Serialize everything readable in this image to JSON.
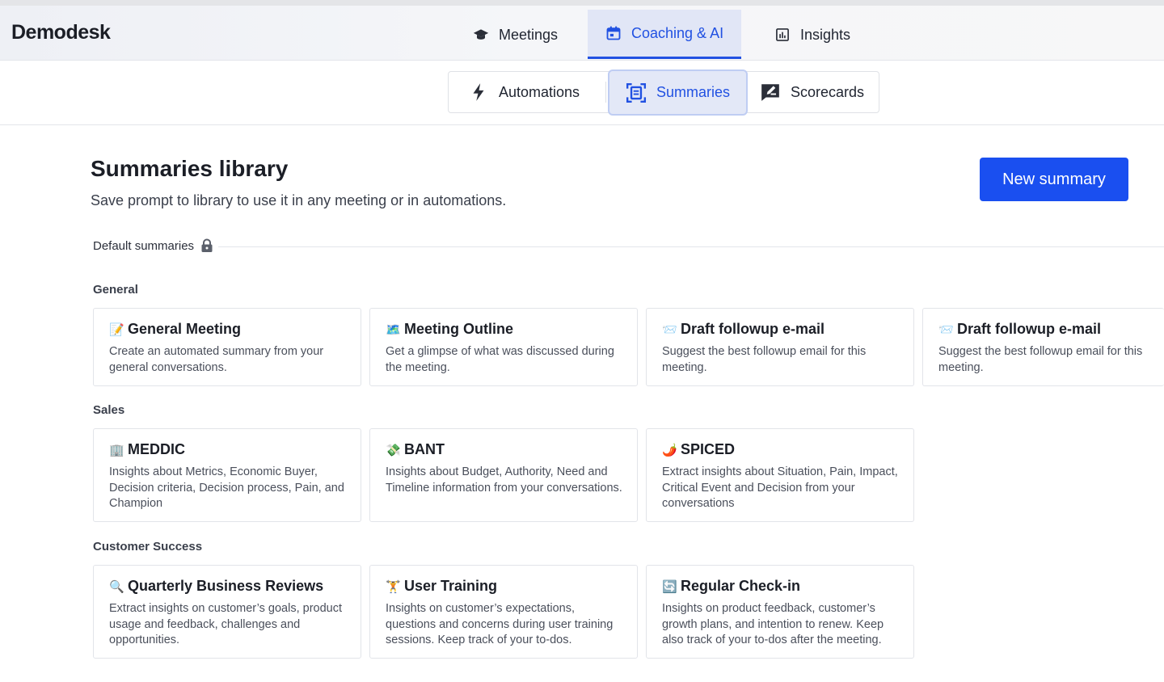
{
  "app": {
    "logo": "Demodesk"
  },
  "main_nav": [
    {
      "label": "Meetings",
      "icon": "graduation-cap-icon",
      "active": false
    },
    {
      "label": "Coaching & AI",
      "icon": "calendar-icon",
      "active": true
    },
    {
      "label": "Insights",
      "icon": "bar-chart-icon",
      "active": false
    }
  ],
  "sub_nav": [
    {
      "label": "Automations",
      "icon": "lightning-icon",
      "active": false
    },
    {
      "label": "Summaries",
      "icon": "document-scan-icon",
      "active": true
    },
    {
      "label": "Scorecards",
      "icon": "scorecard-edit-icon",
      "active": false
    }
  ],
  "page": {
    "title": "Summaries library",
    "subtitle": "Save prompt to library to use it in any meeting or in automations.",
    "new_button": "New summary",
    "default_label": "Default summaries"
  },
  "sections": [
    {
      "label": "General",
      "cards": [
        {
          "emoji": "📝",
          "title": "General Meeting",
          "desc": "Create an automated summary from your general conversations."
        },
        {
          "emoji": "🗺️",
          "title": "Meeting Outline",
          "desc": "Get a glimpse of what was discussed during the meeting."
        },
        {
          "emoji": "📨",
          "title": "Draft followup e-mail",
          "desc": "Suggest the best followup email for this meeting."
        },
        {
          "emoji": "📨",
          "title": "Draft followup e-mail",
          "desc": "Suggest the best followup email for this meeting."
        }
      ]
    },
    {
      "label": "Sales",
      "cards": [
        {
          "emoji": "🏢",
          "title": "MEDDIC",
          "desc": "Insights about Metrics, Economic Buyer, Decision criteria, Decision process, Pain, and Champion"
        },
        {
          "emoji": "💸",
          "title": "BANT",
          "desc": "Insights about Budget, Authority, Need and Timeline information from your conversations."
        },
        {
          "emoji": "🌶️",
          "title": "SPICED",
          "desc": "Extract insights about Situation, Pain, Impact, Critical Event and Decision from your conversations"
        }
      ]
    },
    {
      "label": "Customer Success",
      "cards": [
        {
          "emoji": "🔍",
          "title": "Quarterly Business Reviews",
          "desc": "Extract insights on customer’s goals, product usage and feedback, challenges and opportunities."
        },
        {
          "emoji": "🏋️",
          "title": "User Training",
          "desc": "Insights on customer’s expectations, questions and concerns during user training sessions. Keep  track of your to-dos."
        },
        {
          "emoji": "🔄",
          "title": "Regular Check-in",
          "desc": "Insights on product feedback, customer’s growth plans, and intention to renew. Keep also track of your to-dos after the meeting."
        }
      ]
    }
  ],
  "colors": {
    "accent": "#2151e2",
    "button": "#1a4ff0",
    "active_tab_bg": "#e1e6f6"
  }
}
